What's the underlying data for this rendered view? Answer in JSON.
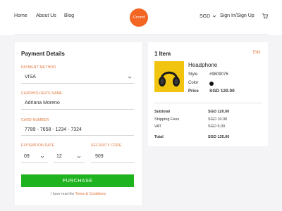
{
  "nav": {
    "links": [
      "Home",
      "About Us",
      "Blog"
    ],
    "logo_text": "Grand",
    "currency": "SGD",
    "signin": "Sign In/Sign Up"
  },
  "payment": {
    "title": "Payment Details",
    "method_label": "PAYMENT METHOD",
    "method_value": "VISA",
    "holder_label": "CARDHOLDER'S NAME",
    "holder_value": "Adriana Moreno",
    "number_label": "CARD NUMBER",
    "number_value": "7789 - 7658 - 1234 - 7324",
    "expiry_label": "EXPIRATION DATE",
    "expiry_month": "09",
    "expiry_year": "12",
    "cvv_label": "SECURITY CODE",
    "cvv_value": "909",
    "purchase_label": "PURCHASE",
    "terms_prefix": "I have read the ",
    "terms_link": "Terms & Conditions"
  },
  "cart": {
    "title": "1 Item",
    "edit_label": "Edit",
    "product_name": "Headphone",
    "style_label": "Style",
    "style_value": "#9809076",
    "color_label": "Color",
    "color_value": "#111111",
    "price_label": "Price",
    "price_value": "SGD 120.00",
    "subtotal_label": "Subtotal",
    "subtotal_value": "SGD 120.00",
    "shipping_label": "Shipping Fees",
    "shipping_value": "SGD 10.00",
    "vat_label": "VAT",
    "vat_value": "SGD 5.00",
    "total_label": "Total",
    "total_value": "SGD 135.00"
  },
  "colors": {
    "accent": "#f26522",
    "label_orange": "#e0743a",
    "purchase_green": "#1fb31f",
    "thumb_yellow": "#f1c40f"
  },
  "icons": {
    "select_chevron": "chevron-down-icon",
    "cart": "cart-icon",
    "product_image": "headphone-image"
  }
}
